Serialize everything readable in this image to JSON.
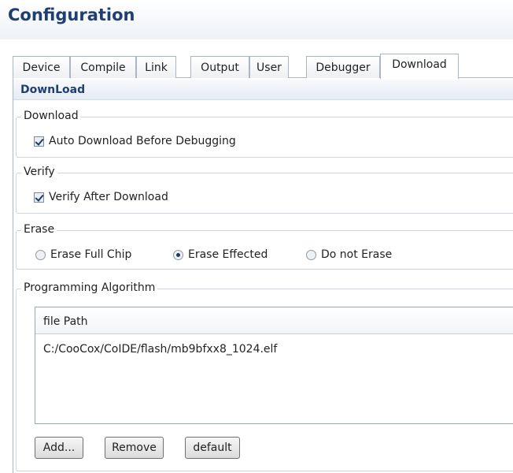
{
  "page": {
    "title": "Configuration"
  },
  "tabs": [
    {
      "label": "Device"
    },
    {
      "label": "Compile"
    },
    {
      "label": "Link"
    },
    {
      "label": "Output"
    },
    {
      "label": "User"
    },
    {
      "label": "Debugger"
    },
    {
      "label": "Download",
      "active": true
    }
  ],
  "panel": {
    "title": "DownLoad"
  },
  "download_group": {
    "legend": "Download",
    "auto_download": {
      "label": "Auto Download Before Debugging",
      "checked": true
    }
  },
  "verify_group": {
    "legend": "Verify",
    "verify_after": {
      "label": "Verify After Download",
      "checked": true
    }
  },
  "erase_group": {
    "legend": "Erase",
    "options": [
      {
        "label": "Erase Full Chip",
        "selected": false
      },
      {
        "label": "Erase Effected",
        "selected": true
      },
      {
        "label": "Do not Erase",
        "selected": false
      }
    ]
  },
  "algorithm_group": {
    "legend": "Programming Algorithm",
    "column_header": "file Path",
    "rows": [
      "C:/CooCox/CoIDE/flash/mb9bfxx8_1024.elf"
    ],
    "buttons": {
      "add": "Add...",
      "remove": "Remove",
      "default": "default"
    }
  },
  "colors": {
    "title": "#1f3f73",
    "border": "#a9b6c6",
    "group_border": "#cfd5dc",
    "check_mark": "#1a3a6a"
  }
}
